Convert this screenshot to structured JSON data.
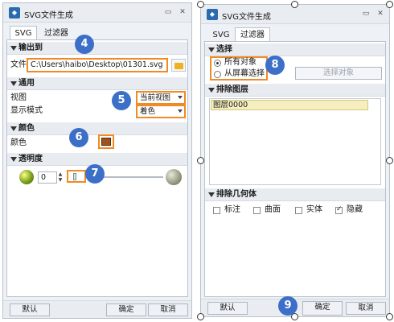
{
  "left": {
    "title": "SVG文件生成",
    "tabs": [
      "SVG",
      "过滤器"
    ],
    "sections": {
      "output": "输出到",
      "general": "通用",
      "color": "颜色",
      "transparency": "透明度"
    },
    "file_label": "文件",
    "file_value": "C:\\Users\\haibo\\Desktop\\01301.svg",
    "view_label": "视图",
    "view_value": "当前视图",
    "display_label": "显示模式",
    "display_value": "着色",
    "color_label": "颜色",
    "color_swatch": "#a0521d",
    "transparency_value": "0",
    "transparency_level": 0,
    "buttons": {
      "default": "默认",
      "ok": "确定",
      "cancel": "取消"
    }
  },
  "right": {
    "title": "SVG文件生成",
    "tabs": [
      "SVG",
      "过滤器"
    ],
    "sections": {
      "select": "选择",
      "exclude_layers": "排除图层",
      "exclude_geometry": "排除几何体"
    },
    "radio_all": "所有对象",
    "radio_screen": "从屏幕选择",
    "select_button": "选择对象",
    "layers": [
      "图层0000"
    ],
    "checkboxes": [
      {
        "label": "标注",
        "checked": false
      },
      {
        "label": "曲面",
        "checked": false
      },
      {
        "label": "实体",
        "checked": false
      },
      {
        "label": "隐藏",
        "checked": true
      }
    ],
    "buttons": {
      "default": "默认",
      "ok": "确定",
      "cancel": "取消"
    }
  },
  "badges": [
    "4",
    "5",
    "6",
    "7",
    "8",
    "9"
  ],
  "colors": {
    "accent": "#3c6fc8",
    "highlight": "#f08a24",
    "layer_bg": "#f4eec0"
  }
}
